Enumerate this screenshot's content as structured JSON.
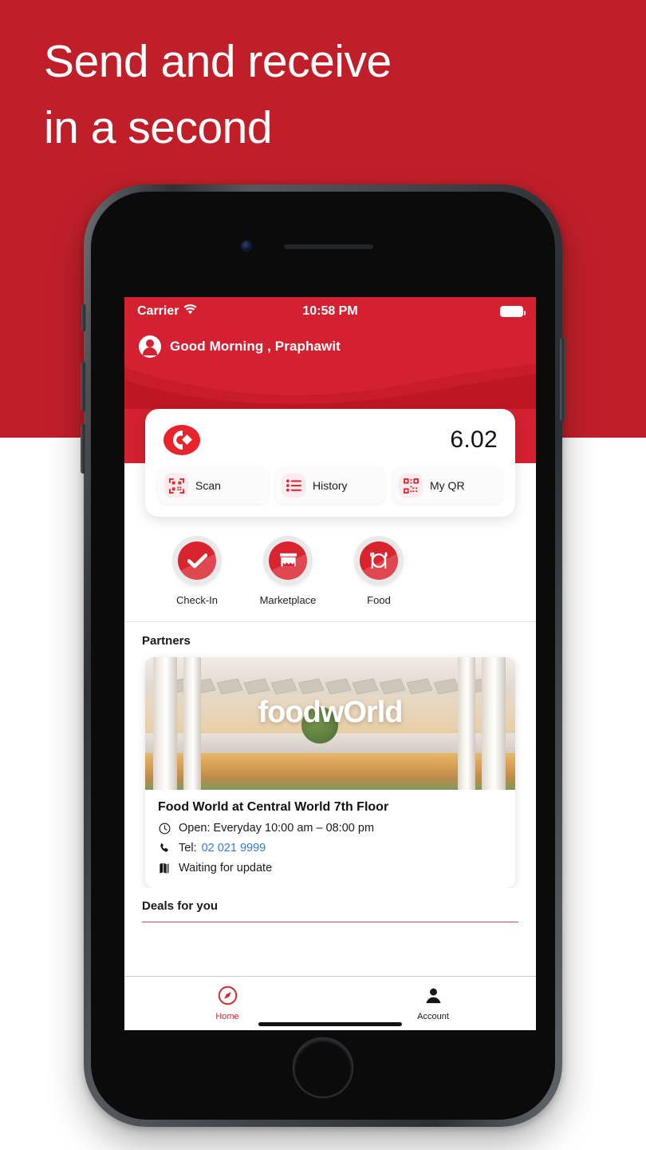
{
  "promo": {
    "headline": "Send and receive\nin a second",
    "background_color": "#C01F2A"
  },
  "phone": {
    "status_bar": {
      "carrier": "Carrier",
      "wifi_icon": "wifi-icon",
      "time": "10:58 PM",
      "battery_icon": "battery-full-icon"
    },
    "header": {
      "avatar_icon": "person-avatar-icon",
      "greeting": "Good Morning , Praphawit",
      "background_color": "#D32131"
    },
    "balance_card": {
      "logo_icon": "brand-c-logo-icon",
      "amount": "6.02",
      "actions": [
        {
          "label": "Scan",
          "icon": "qr-scan-icon"
        },
        {
          "label": "History",
          "icon": "list-icon"
        },
        {
          "label": "My QR",
          "icon": "qr-code-icon"
        }
      ]
    },
    "quick_actions": [
      {
        "label": "Check-In",
        "icon": "check-circle-icon"
      },
      {
        "label": "Marketplace",
        "icon": "store-icon"
      },
      {
        "label": "Food",
        "icon": "food-plate-icon"
      }
    ],
    "partners": {
      "section_title": "Partners",
      "card": {
        "image_logo_text": "foodwOrld",
        "image_alt": "food-world-storefront-image",
        "title": "Food World at Central World 7th Floor",
        "open_icon": "clock-icon",
        "open_text": "Open: Everyday  10:00 am – 08:00 pm",
        "tel_icon": "phone-icon",
        "tel_label": "Tel:",
        "tel_number": "02 021 9999",
        "map_icon": "map-icon",
        "map_text": "Waiting for update"
      }
    },
    "deals": {
      "section_title": "Deals for you"
    },
    "tabbar": {
      "tabs": [
        {
          "label": "Home",
          "icon": "compass-icon",
          "active": true
        },
        {
          "label": "Account",
          "icon": "person-icon",
          "active": false
        }
      ],
      "active_color": "#D9232D",
      "inactive_color": "#161616"
    }
  }
}
